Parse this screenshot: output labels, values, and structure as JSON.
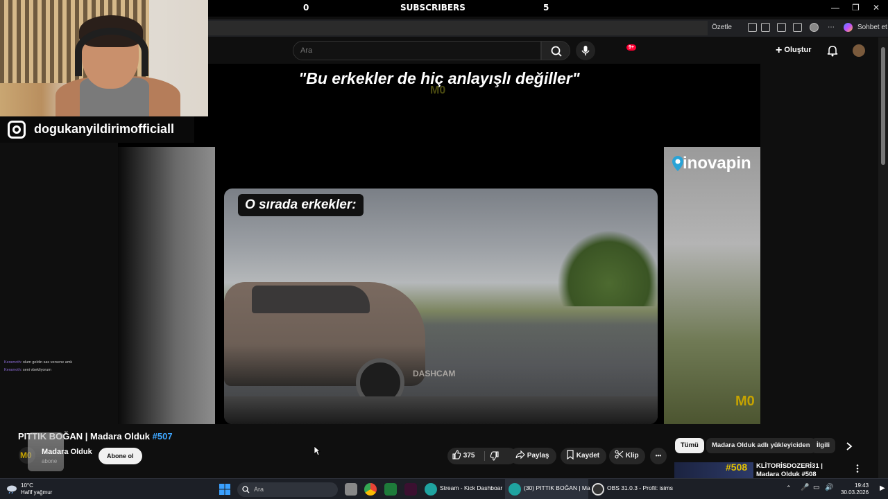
{
  "overlay": {
    "counter_left": "0",
    "label": "SUBSCRIBERS",
    "counter_right": "5",
    "instagram_handle": "dogukanyildirimofficiall"
  },
  "browser": {
    "summarize_label": "Özetle",
    "chat_label": "Sohbet et"
  },
  "youtube": {
    "search_placeholder": "Ara",
    "create_label": "Oluştur",
    "notifications_badge": "9+"
  },
  "video": {
    "title_overlay": "\"Bu erkekler de hiç anlayışlı değiller\"",
    "caption": "O sırada erkekler:",
    "sponsor": "inovapin",
    "watermark": "DASHCAM",
    "channel_logo_text": "M0"
  },
  "chat": [
    {
      "name": "Keramoth",
      "text": ": olum geldin sas versene amk"
    },
    {
      "name": "Keramoth",
      "text": ": seni vbekliyorum"
    }
  ],
  "watch": {
    "title": "PITTIK BOĞAN | Madara Olduk",
    "title_tag": "#507",
    "channel_name": "Madara Olduk",
    "channel_subs": "abone",
    "subscribe_label": "Abone ol",
    "likes": "375",
    "share_label": "Paylaş",
    "save_label": "Kaydet",
    "clip_label": "Klip",
    "more_label": "•••"
  },
  "chips": [
    "Tümü",
    "Madara Olduk adlı yükleyiciden",
    "İlgili"
  ],
  "recommended": {
    "tag": "#508",
    "title": "KLİTORİSDOZERİ31 | Madara Olduk #508"
  },
  "taskbar": {
    "weather_temp": "10°C",
    "weather_desc": "Hafif yağmur",
    "search_placeholder": "Ara",
    "tasks": [
      "Stream - Kick Dashboar",
      "(30) PITTIK BOĞAN | Ma",
      "OBS 31.0.3 - Profil: isims"
    ],
    "time": "19:43",
    "date": "30.03.2026"
  },
  "colors": {
    "accent_blue": "#3ea6ff",
    "badge_red": "#ff0033",
    "watermark_gold": "#c6a300"
  }
}
